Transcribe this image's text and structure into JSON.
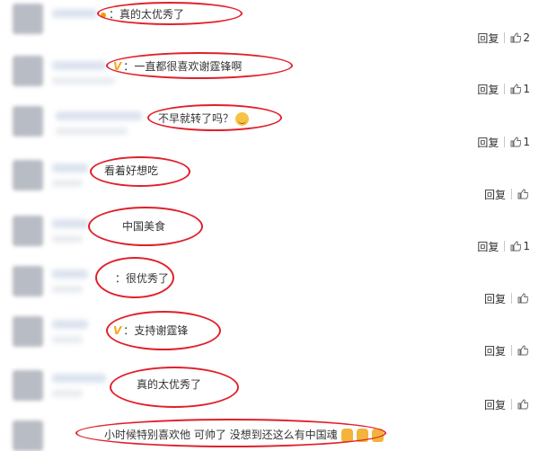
{
  "comments": [
    {
      "text": "真的太优秀了",
      "prefix": "dot",
      "reply": "回复",
      "likes": "2"
    },
    {
      "text": "一直都很喜欢谢霆锋啊",
      "prefix": "v",
      "reply": "回复",
      "likes": "1"
    },
    {
      "text": "不早就转了吗？",
      "prefix": "none",
      "reply": "回复",
      "likes": "1",
      "emoji": "laugh-emoji"
    },
    {
      "text": "看着好想吃",
      "prefix": "none",
      "reply": "回复",
      "likes": ""
    },
    {
      "text": "中国美食",
      "prefix": "none",
      "reply": "回复",
      "likes": "1"
    },
    {
      "text": "很优秀了",
      "prefix": "colon",
      "reply": "回复",
      "likes": ""
    },
    {
      "text": "支持谢霆锋",
      "prefix": "v",
      "reply": "回复",
      "likes": ""
    },
    {
      "text": "真的太优秀了",
      "prefix": "none",
      "reply": "回复",
      "likes": ""
    },
    {
      "text": "小时候特别喜欢他 可帅了 没想到还这么有中国魂",
      "prefix": "none",
      "reply": "",
      "likes": "",
      "emoji": "thumbs-up-emoji"
    }
  ],
  "v_badge": "V",
  "colon": "：",
  "colors": {
    "highlight": "#e0202a",
    "badge": "#f5a623",
    "text": "#333333"
  }
}
